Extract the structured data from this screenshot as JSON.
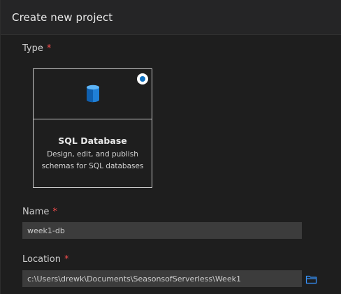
{
  "dialog": {
    "title": "Create new project"
  },
  "type_field": {
    "label": "Type",
    "required_marker": "*",
    "selected_card": {
      "title": "SQL Database",
      "description_line1": "Design, edit, and publish",
      "description_line2": "schemas for SQL databases",
      "icon": "database-icon",
      "selected": true
    }
  },
  "name_field": {
    "label": "Name",
    "required_marker": "*",
    "value": "week1-db"
  },
  "location_field": {
    "label": "Location",
    "required_marker": "*",
    "value": "c:\\Users\\drewk\\Documents\\SeasonsofServerless\\Week1",
    "browse_icon": "folder-icon"
  },
  "colors": {
    "accent": "#0e70c0",
    "required": "#f14c4c",
    "background": "#1e1e1e",
    "input_background": "#3c3c3c"
  }
}
